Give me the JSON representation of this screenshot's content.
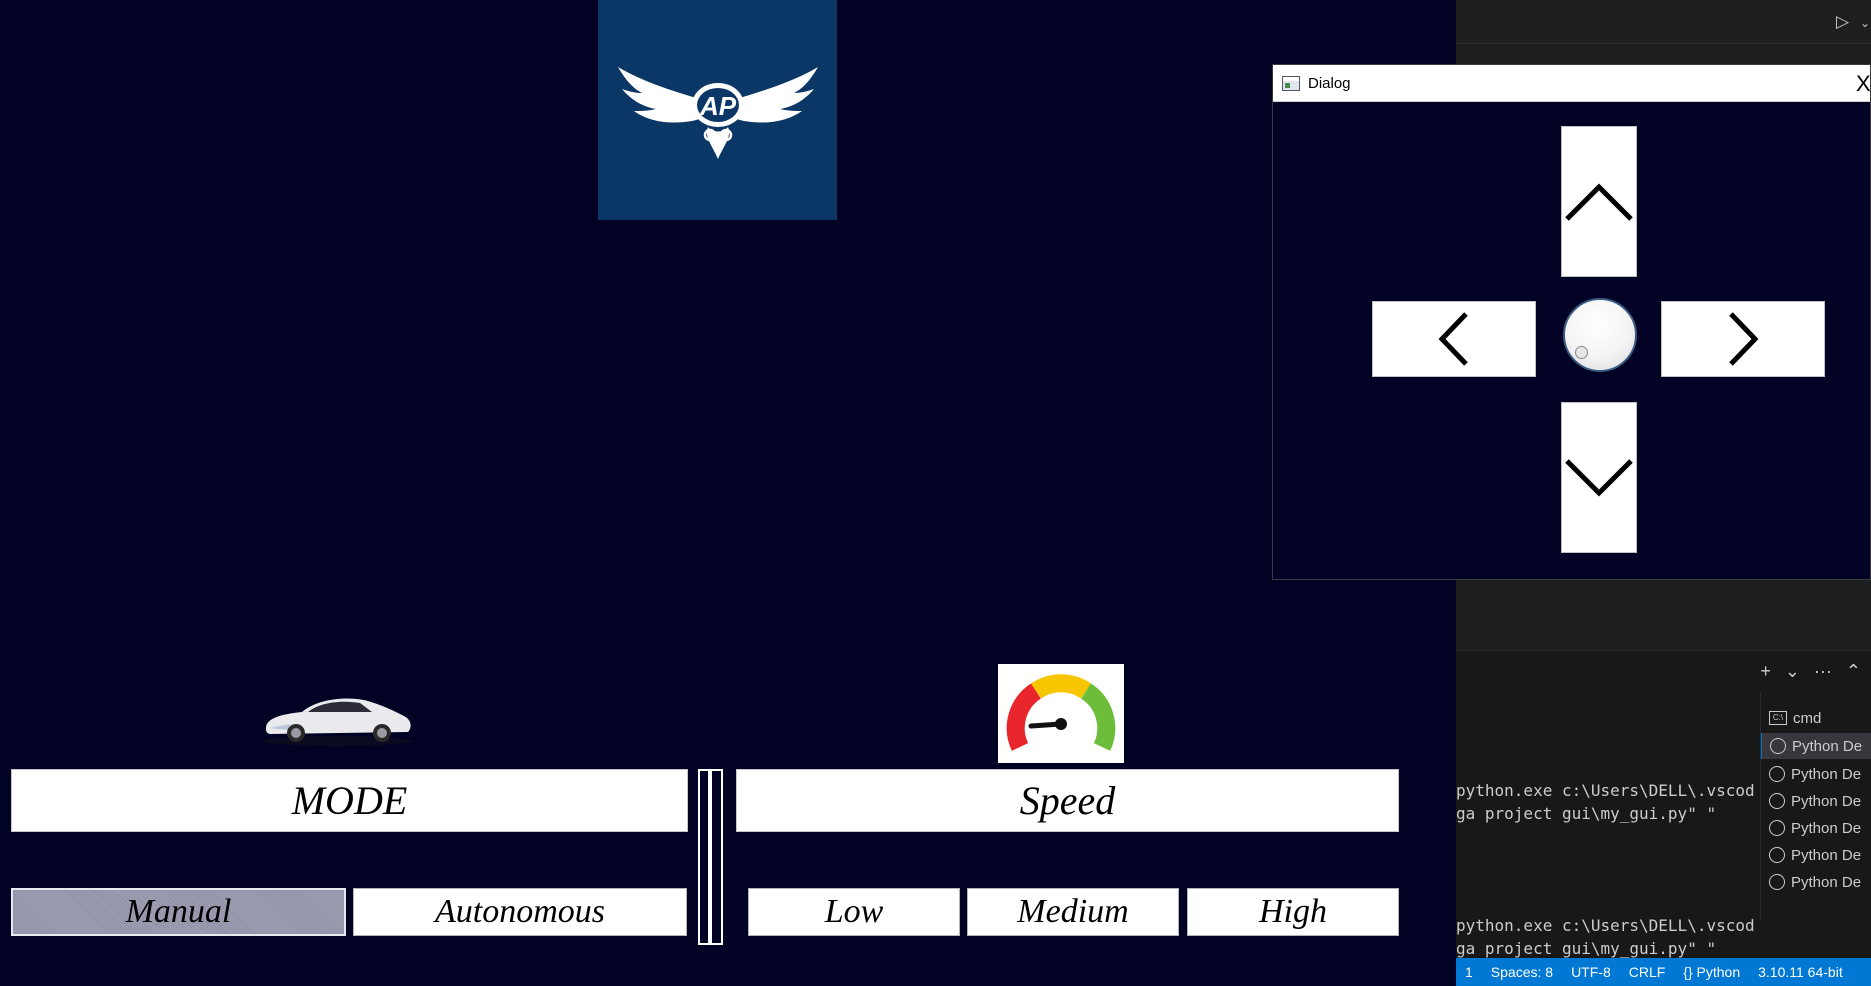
{
  "main": {
    "mode_label": "MODE",
    "speed_label": "Speed",
    "mode_options": [
      "Manual",
      "Autonomous"
    ],
    "selected_mode": "Manual",
    "speed_options": [
      "Low",
      "Medium",
      "High"
    ],
    "logo_text": "AP"
  },
  "dialog": {
    "title": "Dialog",
    "close": "X",
    "controls": [
      "up",
      "left",
      "dial",
      "right",
      "down"
    ]
  },
  "vscode": {
    "terminal_lines": [
      "python.exe c:\\Users\\DELL\\.vscod",
      "ga project gui\\my_gui.py\" \"",
      "python.exe c:\\Users\\DELL\\.vscod",
      "ga project gui\\my_gui.py\" \""
    ],
    "terminals": [
      "cmd",
      "Python De",
      "Python De",
      "Python De",
      "Python De",
      "Python De",
      "Python De"
    ],
    "panel_actions": [
      "+",
      "⌄",
      "···",
      "⌃"
    ],
    "statusbar": [
      "1",
      "Spaces: 8",
      "UTF-8",
      "CRLF",
      "{} Python",
      "3.10.11 64-bit"
    ]
  },
  "colors": {
    "app_background": "#020224",
    "logo_background": "#0b3766",
    "statusbar": "#0078d4"
  }
}
